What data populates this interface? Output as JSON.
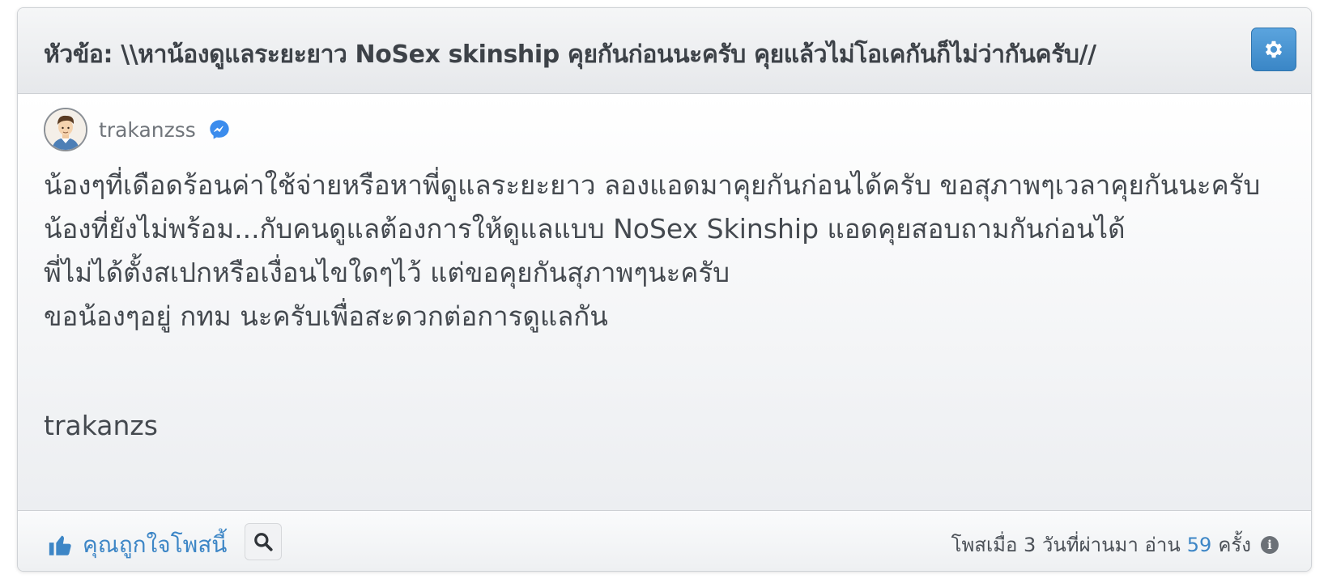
{
  "post": {
    "title": "หัวข้อ: \\\\หาน้องดูแลระยะยาว NoSex skinship คุยกันก่อนนะครับ คุยแล้วไม่โอเคกันก็ไม่ว่ากันครับ//",
    "author": "trakanzss",
    "content_lines": [
      "น้องๆที่เดือดร้อนค่าใช้จ่ายหรือหาพี่ดูแลระยะยาว ลองแอดมาคุยกันก่อนได้ครับ ขอสุภาพๆเวลาคุยกันนะครับน้องที่ยังไม่พร้อม...กับคนดูแลต้องการให้ดูแลแบบ NoSex Skinship แอดคุยสอบถามกันก่อนได้",
      "พี่ไม่ได้ตั้งสเปกหรือเงื่อนไขใดๆไว้ แต่ขอคุยกันสุภาพๆนะครับ",
      "ขอน้องๆอยู่ กทม นะครับเพื่อสะดวกต่อการดูแลกัน"
    ],
    "signature": "trakanzs"
  },
  "footer": {
    "like_label": "คุณถูกใจโพสนี้",
    "posted_prefix": "โพสเมื่อ 3 วันที่ผ่านมา อ่าน",
    "read_count": "59",
    "read_suffix": "ครั้ง"
  },
  "icons": {
    "settings": "gear-icon",
    "messenger": "messenger-icon",
    "like": "thumbs-up-icon",
    "search": "search-icon",
    "info": "info-icon"
  },
  "colors": {
    "accent": "#3d86c6",
    "gear_button": "#4a94d2",
    "text": "#44494f"
  }
}
